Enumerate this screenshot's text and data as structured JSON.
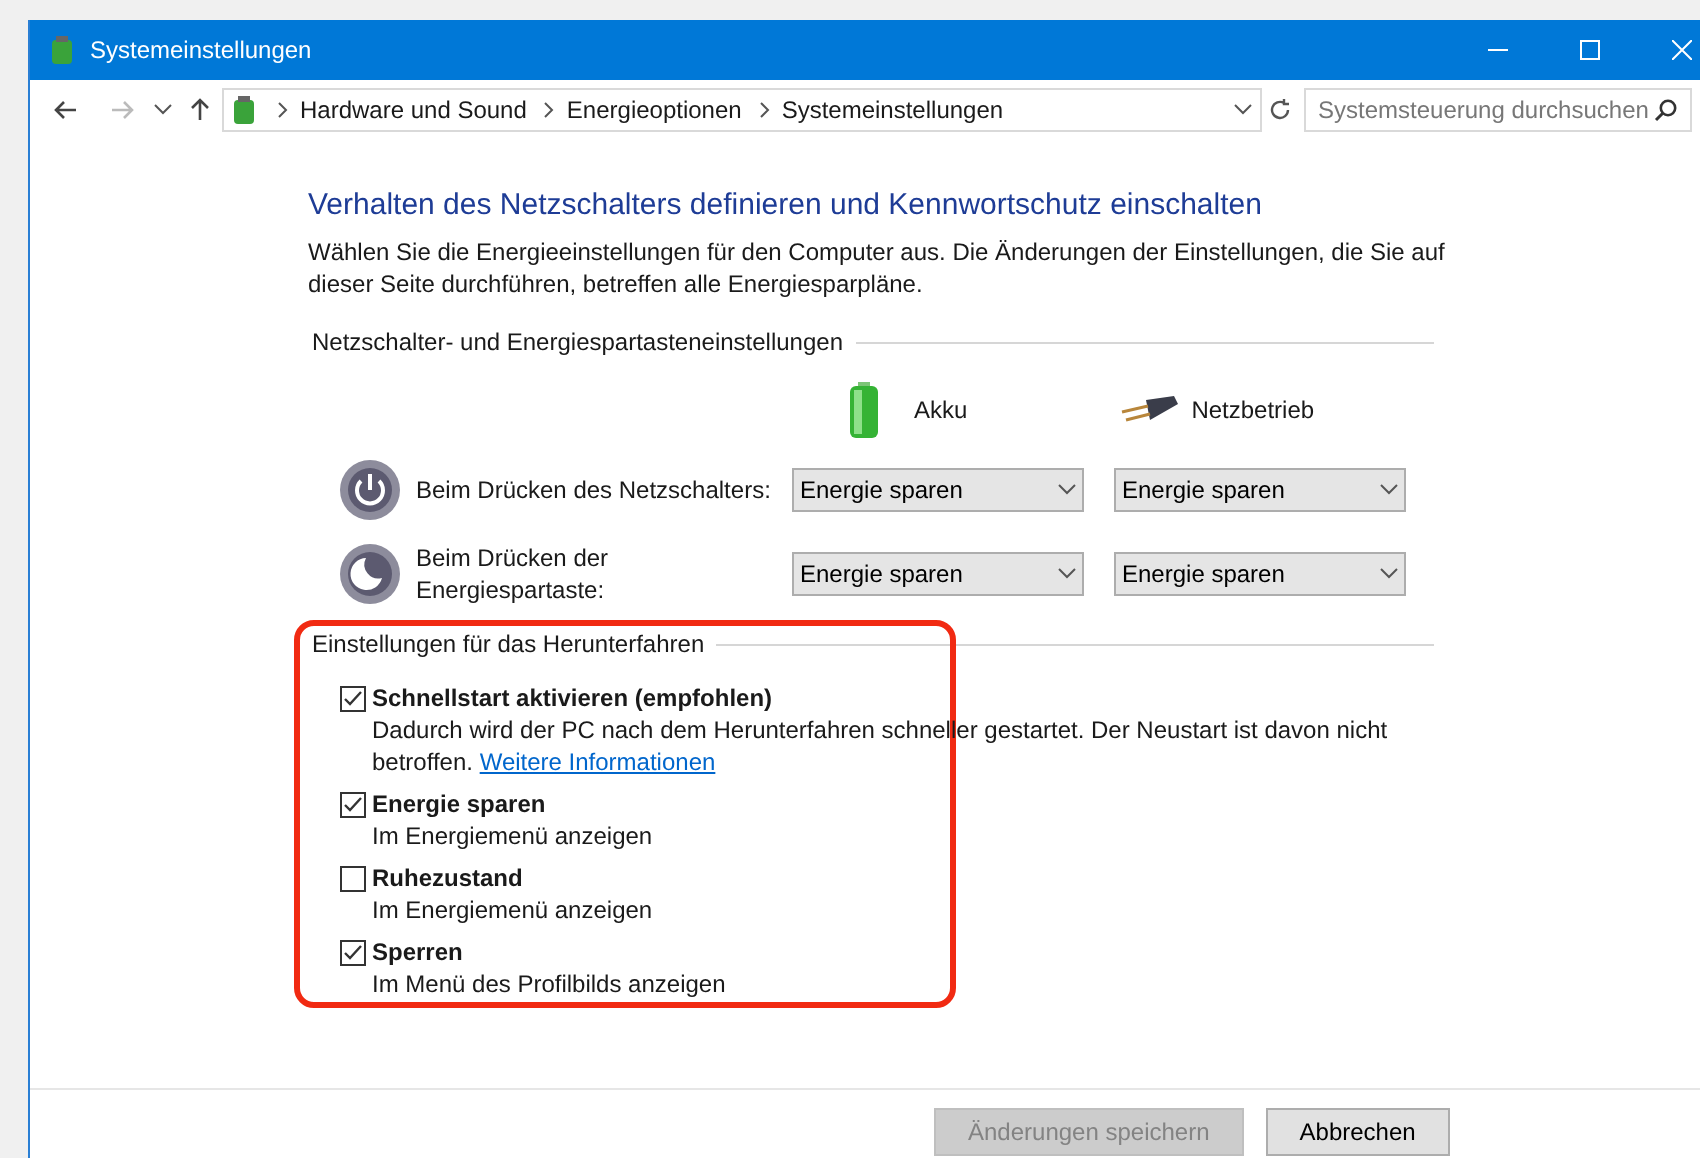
{
  "window": {
    "title": "Systemeinstellungen"
  },
  "address_bar": {
    "breadcrumbs": [
      "Hardware und Sound",
      "Energieoptionen",
      "Systemeinstellungen"
    ],
    "search": {
      "placeholder": "Systemsteuerung durchsuchen"
    }
  },
  "heading": "Verhalten des Netzschalters definieren und Kennwortschutz einschalten",
  "intro": "Wählen Sie die Energieeinstellungen für den Computer aus. Die Änderungen der Einstellungen, die Sie auf dieser Seite durchführen, betreffen alle Energiesparpläne.",
  "button_settings": {
    "title": "Netzschalter- und Energiespartasteneinstellungen",
    "columns": [
      "Akku",
      "Netzbetrieb"
    ],
    "rows": [
      {
        "kind": "power",
        "label": "Beim Drücken des Netzschalters:",
        "values": [
          "Energie sparen",
          "Energie sparen"
        ]
      },
      {
        "kind": "sleep",
        "label": "Beim Drücken der Energiespartaste:",
        "values": [
          "Energie sparen",
          "Energie sparen"
        ]
      }
    ]
  },
  "shutdown_settings": {
    "title": "Einstellungen für das Herunterfahren",
    "items": [
      {
        "label": "Schnellstart aktivieren (empfohlen)",
        "checked": true,
        "description": "Dadurch wird der PC nach dem Herunterfahren schneller gestartet. Der Neustart ist davon nicht betroffen.",
        "link": "Weitere Informationen"
      },
      {
        "label": "Energie sparen",
        "checked": true,
        "description": "Im Energiemenü anzeigen"
      },
      {
        "label": "Ruhezustand",
        "checked": false,
        "description": "Im Energiemenü anzeigen"
      },
      {
        "label": "Sperren",
        "checked": true,
        "description": "Im Menü des Profilbilds anzeigen"
      }
    ]
  },
  "footer": {
    "buttons": [
      {
        "label": "Änderungen speichern",
        "disabled": true
      },
      {
        "label": "Abbrechen",
        "disabled": false
      }
    ]
  }
}
